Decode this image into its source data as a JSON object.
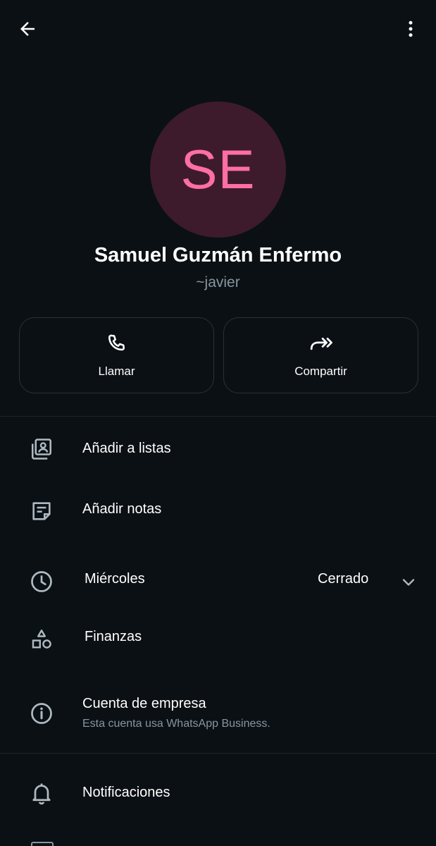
{
  "contact": {
    "initials": "SE",
    "name": "Samuel Guzmán Enfermo",
    "username": "~javier"
  },
  "colors": {
    "background": "#0b1014",
    "avatar_bg": "#3d1b2c",
    "avatar_text": "#ff6ea6",
    "secondary_text": "#8696a0"
  },
  "actions": {
    "call_label": "Llamar",
    "share_label": "Compartir"
  },
  "menu": {
    "add_to_lists": "Añadir a listas",
    "add_notes": "Añadir notas",
    "hours_day": "Miércoles",
    "hours_status": "Cerrado",
    "category": "Finanzas",
    "business_title": "Cuenta de empresa",
    "business_subtitle": "Esta cuenta usa WhatsApp Business.",
    "notifications": "Notificaciones"
  },
  "icons": {
    "back": "arrow-left-icon",
    "more": "more-vertical-icon",
    "call": "phone-icon",
    "share": "forward-icon",
    "lists": "contact-list-icon",
    "notes": "note-icon",
    "hours": "clock-icon",
    "category": "shapes-icon",
    "business": "info-icon",
    "expand": "chevron-down-icon",
    "notifications": "bell-icon"
  }
}
